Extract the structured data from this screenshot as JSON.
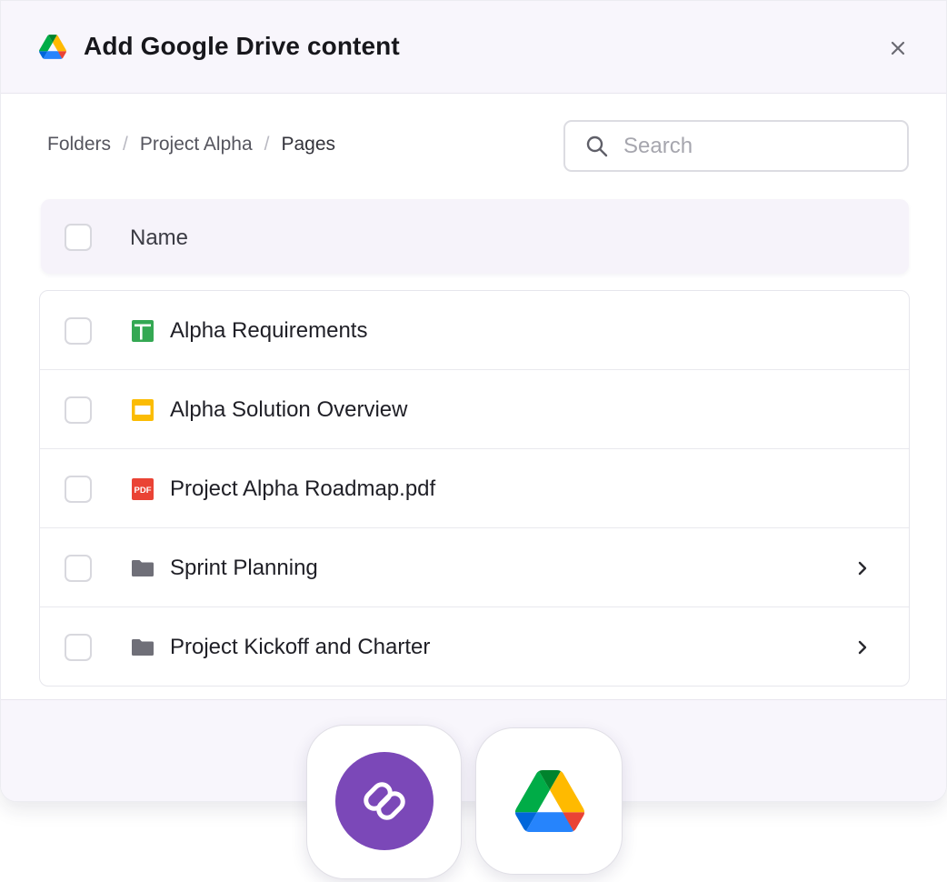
{
  "dialog": {
    "title": "Add Google Drive content",
    "logo_icon": "google-drive-icon",
    "close_icon": "close-icon"
  },
  "breadcrumb": {
    "items": [
      "Folders",
      "Project Alpha",
      "Pages"
    ],
    "separator": "/"
  },
  "search": {
    "placeholder": "Search",
    "value": "",
    "icon": "search-icon"
  },
  "table": {
    "columns": [
      "Name"
    ],
    "rows": [
      {
        "name": "Alpha Requirements",
        "icon": "google-sheets-icon",
        "type": "spreadsheet",
        "has_children": false
      },
      {
        "name": "Alpha Solution Overview",
        "icon": "google-slides-icon",
        "type": "presentation",
        "has_children": false
      },
      {
        "name": "Project Alpha Roadmap.pdf",
        "icon": "pdf-icon",
        "type": "pdf",
        "pdf_badge": "PDF",
        "has_children": false
      },
      {
        "name": "Sprint Planning",
        "icon": "folder-icon",
        "type": "folder",
        "has_children": true
      },
      {
        "name": "Project Kickoff and Charter",
        "icon": "folder-icon",
        "type": "folder",
        "has_children": true
      }
    ]
  },
  "footer": {
    "apps": [
      {
        "name": "purple-app-logo",
        "color": "#7b48b8"
      },
      {
        "name": "google-drive-logo"
      }
    ]
  },
  "colors": {
    "header_bg": "#f8f6fc",
    "sheets_green": "#34a853",
    "slides_yellow": "#fbbc04",
    "pdf_red": "#ea4335",
    "folder_gray": "#6f6f78",
    "brand_purple": "#7b48b8"
  }
}
